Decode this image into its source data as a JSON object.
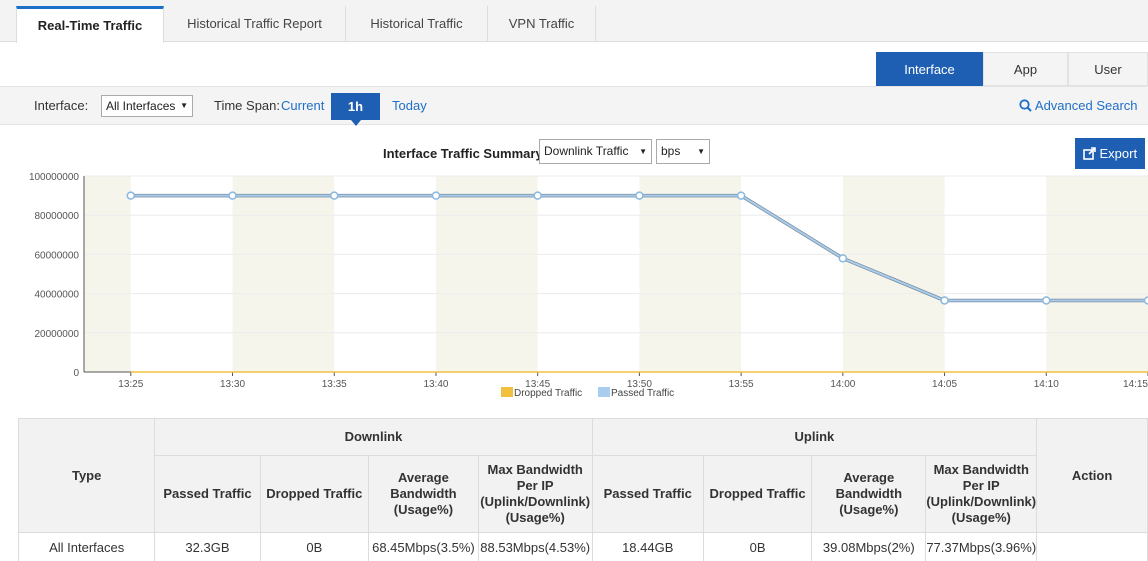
{
  "tabs": [
    {
      "label": "Real-Time Traffic",
      "active": true
    },
    {
      "label": "Historical Traffic Report",
      "active": false
    },
    {
      "label": "Historical Traffic",
      "active": false
    },
    {
      "label": "VPN Traffic",
      "active": false
    }
  ],
  "view_toggle": {
    "interface": "Interface",
    "app": "App",
    "user": "User",
    "active": "Interface"
  },
  "filter": {
    "interface_label": "Interface:",
    "interface_value": "All Interfaces",
    "timespan_label": "Time Span:",
    "current": "Current",
    "one_hour": "1h",
    "today": "Today",
    "advanced_search": "Advanced Search"
  },
  "chart_header": {
    "title": "Interface Traffic Summary",
    "direction_select": "Downlink Traffic",
    "unit_select": "bps",
    "export": "Export"
  },
  "chart_data": {
    "type": "line",
    "ylim": [
      0,
      100000000
    ],
    "yticks": [
      "100000000",
      "80000000",
      "60000000",
      "40000000",
      "20000000",
      "0"
    ],
    "ytick_values": [
      100000000,
      80000000,
      60000000,
      40000000,
      20000000,
      0
    ],
    "xtick_labels": [
      "13:25",
      "13:30",
      "13:35",
      "13:40",
      "13:45",
      "13:50",
      "13:55",
      "14:00",
      "14:05",
      "14:10",
      "14:15"
    ],
    "x_minutes": [
      0,
      5,
      10,
      15,
      20,
      25,
      30,
      35,
      40,
      45,
      50,
      55
    ],
    "series": [
      {
        "name": "Dropped Traffic",
        "color": "#f0c040",
        "values": [
          0,
          0,
          0,
          0,
          0,
          0,
          0,
          0,
          0,
          0,
          0,
          0
        ]
      },
      {
        "name": "Passed Traffic",
        "color": "#a8cdee",
        "values": [
          90000000,
          90000000,
          90000000,
          90000000,
          90000000,
          90000000,
          90000000,
          58000000,
          36500000,
          36500000,
          36500000,
          36500000
        ]
      }
    ],
    "legend_position": "bottom-center"
  },
  "table": {
    "group_headers": {
      "type": "Type",
      "downlink": "Downlink",
      "uplink": "Uplink",
      "action": "Action"
    },
    "sub_headers": {
      "passed": "Passed Traffic",
      "dropped": "Dropped Traffic",
      "average": [
        "Average",
        "Bandwidth",
        "(Usage%)"
      ],
      "max": [
        "Max Bandwidth",
        "Per IP",
        "(Uplink/Downlink)",
        "(Usage%)"
      ]
    },
    "rows": [
      {
        "type": "All Interfaces",
        "down_passed": "32.3GB",
        "down_dropped": "0B",
        "down_avg": "68.45Mbps(3.5%)",
        "down_max": "88.53Mbps(4.53%)",
        "up_passed": "18.44GB",
        "up_dropped": "0B",
        "up_avg": "39.08Mbps(2%)",
        "up_max": "77.37Mbps(3.96%)",
        "action": ""
      }
    ]
  }
}
